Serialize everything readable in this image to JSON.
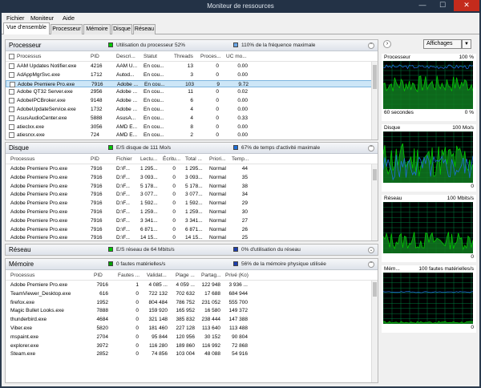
{
  "window": {
    "title": "Moniteur de ressources",
    "min_glyph": "—",
    "max_glyph": "☐",
    "close_glyph": "✕"
  },
  "menu": [
    "Fichier",
    "Moniteur",
    "Aide"
  ],
  "tabs": [
    "Vue d'ensemble",
    "Processeur",
    "Mémoire",
    "Disque",
    "Réseau"
  ],
  "cpu": {
    "title": "Processeur",
    "stat1": "Utilisation du processeur 52%",
    "stat2": "110% de la fréquence maximale",
    "columns": [
      "Processus",
      "PID",
      "Descri...",
      "Statut",
      "Threads",
      "Proces...",
      "UC mo..."
    ],
    "rows": [
      [
        "AAM Updates Notifier.exe",
        "4216",
        "AAM U...",
        "En cou...",
        "13",
        "0",
        "0.00"
      ],
      [
        "AdAppMgrSvc.exe",
        "1712",
        "Autod...",
        "En cou...",
        "3",
        "0",
        "0.00"
      ],
      [
        "Adobe Premiere Pro.exe",
        "7916",
        "Adobe ...",
        "En cou...",
        "103",
        "9",
        "9.72"
      ],
      [
        "Adobe QT32 Server.exe",
        "2956",
        "Adobe ...",
        "En cou...",
        "11",
        "0",
        "0.02"
      ],
      [
        "AdobeIPCBroker.exe",
        "9148",
        "Adobe ...",
        "En cou...",
        "6",
        "0",
        "0.00"
      ],
      [
        "AdobeUpdateService.exe",
        "1732",
        "Adobe ...",
        "En cou...",
        "4",
        "0",
        "0.00"
      ],
      [
        "AsusAudioCenter.exe",
        "5888",
        "AsusA...",
        "En cou...",
        "4",
        "0",
        "0.33"
      ],
      [
        "atieclxx.exe",
        "3056",
        "AMD E...",
        "En cou...",
        "8",
        "0",
        "0.00"
      ],
      [
        "atiesrxx.exe",
        "724",
        "AMD E...",
        "En cou...",
        "2",
        "0",
        "0.00"
      ]
    ]
  },
  "disk": {
    "title": "Disque",
    "stat1": "E/S disque de 111 Mo/s",
    "stat2": "67% de temps d'activité maximale",
    "columns": [
      "Processus",
      "PID",
      "Fichier",
      "Lectu...",
      "Écritu...",
      "Total ...",
      "Priori...",
      "Temp..."
    ],
    "rows": [
      [
        "Adobe Premiere Pro.exe",
        "7916",
        "D:\\F...",
        "1 295...",
        "0",
        "1 295...",
        "Normal",
        "44"
      ],
      [
        "Adobe Premiere Pro.exe",
        "7916",
        "D:\\F...",
        "3 093...",
        "0",
        "3 093...",
        "Normal",
        "35"
      ],
      [
        "Adobe Premiere Pro.exe",
        "7916",
        "D:\\F...",
        "5 178...",
        "0",
        "5 178...",
        "Normal",
        "38"
      ],
      [
        "Adobe Premiere Pro.exe",
        "7916",
        "D:\\F...",
        "3 077...",
        "0",
        "3 077...",
        "Normal",
        "34"
      ],
      [
        "Adobe Premiere Pro.exe",
        "7916",
        "D:\\F...",
        "1 592...",
        "0",
        "1 592...",
        "Normal",
        "29"
      ],
      [
        "Adobe Premiere Pro.exe",
        "7916",
        "D:\\F...",
        "1 259...",
        "0",
        "1 259...",
        "Normal",
        "30"
      ],
      [
        "Adobe Premiere Pro.exe",
        "7916",
        "D:\\F...",
        "3 341...",
        "0",
        "3 341...",
        "Normal",
        "27"
      ],
      [
        "Adobe Premiere Pro.exe",
        "7916",
        "D:\\F...",
        "6 871...",
        "0",
        "6 871...",
        "Normal",
        "26"
      ],
      [
        "Adobe Premiere Pro.exe",
        "7916",
        "D:\\F...",
        "14 15...",
        "0",
        "14 15...",
        "Normal",
        "25"
      ]
    ]
  },
  "network": {
    "title": "Réseau",
    "stat1": "E/S réseau de 64 Mbits/s",
    "stat2": "0% d'utilisation du réseau"
  },
  "memory": {
    "title": "Mémoire",
    "stat1": "0 fautes matérielles/s",
    "stat2": "56% de la mémoire physique utilisée",
    "columns": [
      "Processus",
      "PID",
      "Fautes ...",
      "Validat...",
      "Plage ...",
      "Partag...",
      "Privé (Ko)"
    ],
    "rows": [
      [
        "Adobe Premiere Pro.exe",
        "7916",
        "1",
        "4 085 ...",
        "4 059 ...",
        "122 948",
        "3 936 ..."
      ],
      [
        "TeamViewer_Desktop.exe",
        "616",
        "0",
        "722 132",
        "702 632",
        "17 688",
        "684 944"
      ],
      [
        "firefox.exe",
        "1952",
        "0",
        "804 484",
        "786 752",
        "231 052",
        "555 700"
      ],
      [
        "Magic Bullet Looks.exe",
        "7888",
        "0",
        "159 920",
        "165 952",
        "16 580",
        "149 372"
      ],
      [
        "thunderbird.exe",
        "4684",
        "0",
        "321 148",
        "385 832",
        "238 444",
        "147 388"
      ],
      [
        "Viber.exe",
        "5820",
        "0",
        "181 460",
        "227 128",
        "113 640",
        "113 488"
      ],
      [
        "mspaint.exe",
        "2704",
        "0",
        "95 844",
        "120 956",
        "30 152",
        "90 804"
      ],
      [
        "explorer.exe",
        "3972",
        "0",
        "116 280",
        "189 860",
        "116 992",
        "72 868"
      ],
      [
        "Steam.exe",
        "2852",
        "0",
        "74 856",
        "103 004",
        "48 088",
        "54 916"
      ]
    ]
  },
  "right": {
    "views_label": "Affichages",
    "graphs": [
      {
        "name": "Processeur",
        "max": "100 %",
        "foot_left": "60 secondes",
        "foot_right": "0 %"
      },
      {
        "name": "Disque",
        "max": "100 Mo/s",
        "foot_left": "",
        "foot_right": "0"
      },
      {
        "name": "Réseau",
        "max": "100 Mbits/s",
        "foot_left": "",
        "foot_right": "0"
      },
      {
        "name": "Mém...",
        "max": "100 fautes matérielles/s",
        "foot_left": "",
        "foot_right": "0"
      }
    ]
  },
  "colors": {
    "accent_green": "#00c800",
    "accent_blue": "#1e6fd9",
    "graph_bg": "#000000",
    "grid": "#007a3d"
  }
}
